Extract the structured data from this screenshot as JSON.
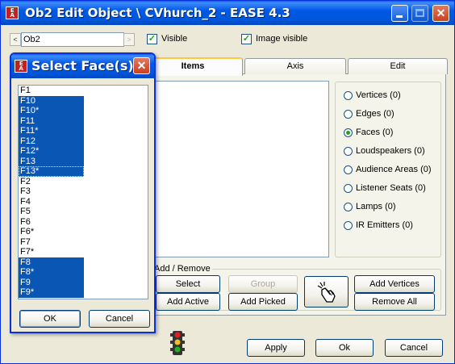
{
  "window": {
    "title": "Ob2 Edit Object \\ CVhurch_2 - EASE 4.3",
    "logo_text": "EASE"
  },
  "top": {
    "object_name": "Ob2",
    "visible_label": "Visible",
    "visible_checked": true,
    "image_visible_label": "Image visible",
    "image_visible_checked": true
  },
  "tabs": [
    {
      "label": "Items",
      "active": true
    },
    {
      "label": "Axis",
      "active": false
    },
    {
      "label": "Edit",
      "active": false
    }
  ],
  "item_types": [
    {
      "label": "Vertices (0)",
      "selected": false
    },
    {
      "label": "Edges (0)",
      "selected": false
    },
    {
      "label": "Faces (0)",
      "selected": true
    },
    {
      "label": "Loudspeakers (0)",
      "selected": false
    },
    {
      "label": "Audience Areas (0)",
      "selected": false
    },
    {
      "label": "Listener Seats (0)",
      "selected": false
    },
    {
      "label": "Lamps (0)",
      "selected": false
    },
    {
      "label": "IR Emitters (0)",
      "selected": false
    }
  ],
  "add_remove": {
    "title": "Add / Remove",
    "select_label": "Select",
    "group_label": "Group",
    "add_active_label": "Add Active",
    "add_picked_label": "Add Picked",
    "add_vertices_label": "Add Vertices",
    "remove_all_label": "Remove All"
  },
  "bottom": {
    "apply_label": "Apply",
    "ok_label": "Ok",
    "cancel_label": "Cancel"
  },
  "dialog": {
    "title": "Select Face(s)",
    "ok_label": "OK",
    "cancel_label": "Cancel",
    "faces": [
      {
        "label": "F1",
        "selected": false
      },
      {
        "label": "F10",
        "selected": true
      },
      {
        "label": "F10*",
        "selected": true
      },
      {
        "label": "F11",
        "selected": true
      },
      {
        "label": "F11*",
        "selected": true
      },
      {
        "label": "F12",
        "selected": true
      },
      {
        "label": "F12*",
        "selected": true
      },
      {
        "label": "F13",
        "selected": true
      },
      {
        "label": "F13*",
        "selected": true,
        "focus": true
      },
      {
        "label": "F2",
        "selected": false
      },
      {
        "label": "F3",
        "selected": false
      },
      {
        "label": "F4",
        "selected": false
      },
      {
        "label": "F5",
        "selected": false
      },
      {
        "label": "F6",
        "selected": false
      },
      {
        "label": "F6*",
        "selected": false
      },
      {
        "label": "F7",
        "selected": false
      },
      {
        "label": "F7*",
        "selected": false
      },
      {
        "label": "F8",
        "selected": true
      },
      {
        "label": "F8*",
        "selected": true
      },
      {
        "label": "F9",
        "selected": true
      },
      {
        "label": "F9*",
        "selected": true
      }
    ]
  },
  "colors": {
    "titlebar": "#0058e6",
    "selection": "#0a56b4",
    "window_bg": "#ece9d8"
  }
}
